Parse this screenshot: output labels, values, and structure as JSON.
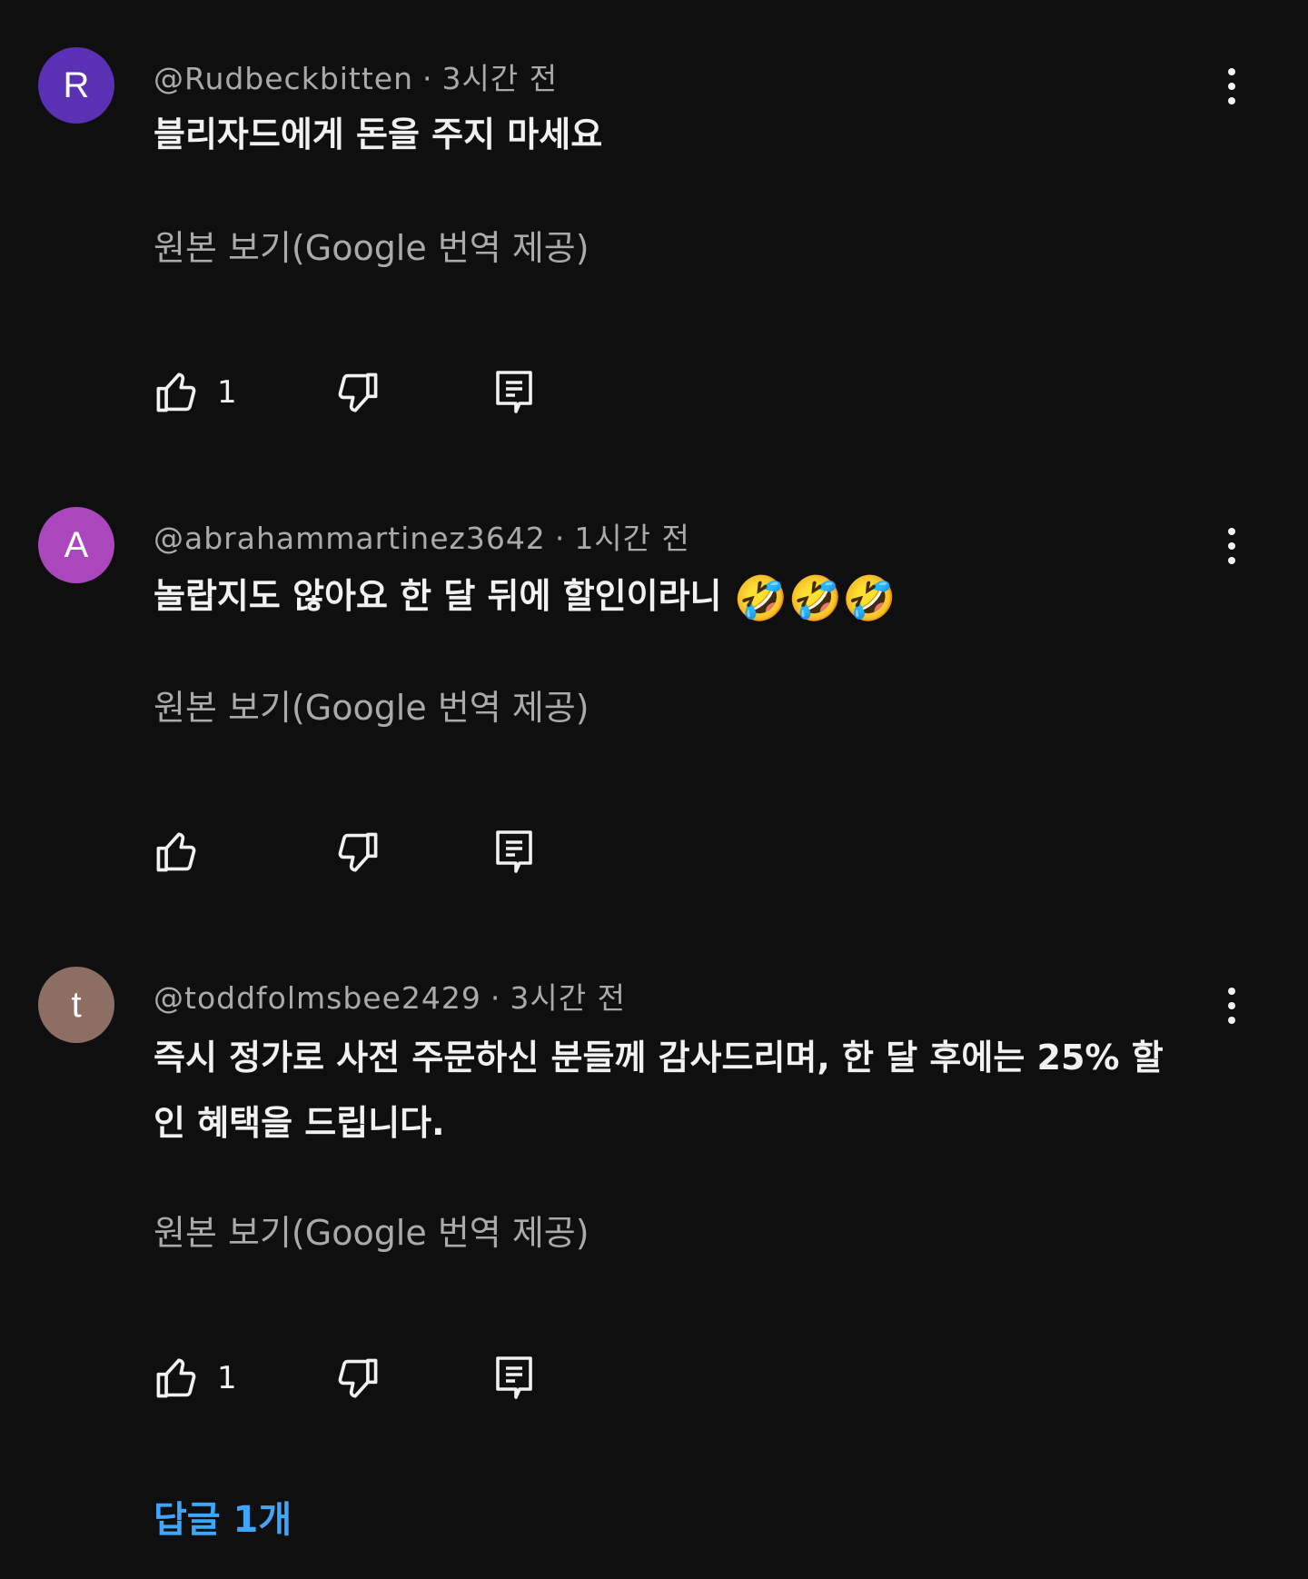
{
  "comments": [
    {
      "avatar_letter": "R",
      "avatar_color": "#5a30b5",
      "handle": "@Rudbeckbitten",
      "time": "3시간 전",
      "text": "블리자드에게 돈을 주지 마세요",
      "emoji": "",
      "translate_label": "원본 보기(Google 번역 제공)",
      "like_count": "1"
    },
    {
      "avatar_letter": "A",
      "avatar_color": "#ab47bc",
      "handle": "@abrahammartinez3642",
      "time": "1시간 전",
      "text": "놀랍지도 않아요 한 달 뒤에 할인이라니",
      "emoji": "🤣🤣🤣",
      "translate_label": "원본 보기(Google 번역 제공)",
      "like_count": ""
    },
    {
      "avatar_letter": "t",
      "avatar_color": "#8d6e63",
      "handle": "@toddfolmsbee2429",
      "time": "3시간 전",
      "text": "즉시 정가로 사전 주문하신 분들께 감사드리며, 한 달 후에는 25% 할인 혜택을 드립니다.",
      "emoji": "",
      "translate_label": "원본 보기(Google 번역 제공)",
      "like_count": "1"
    }
  ],
  "replies_label": "답글 1개",
  "icons": {
    "like": "thumbs-up-icon",
    "dislike": "thumbs-down-icon",
    "reply": "reply-comment-icon",
    "more": "more-vert-icon"
  },
  "colors": {
    "background": "#0f0f0f",
    "primary_text": "#f1f1f1",
    "secondary_text": "#aaaaaa",
    "link": "#3ea6ff"
  }
}
